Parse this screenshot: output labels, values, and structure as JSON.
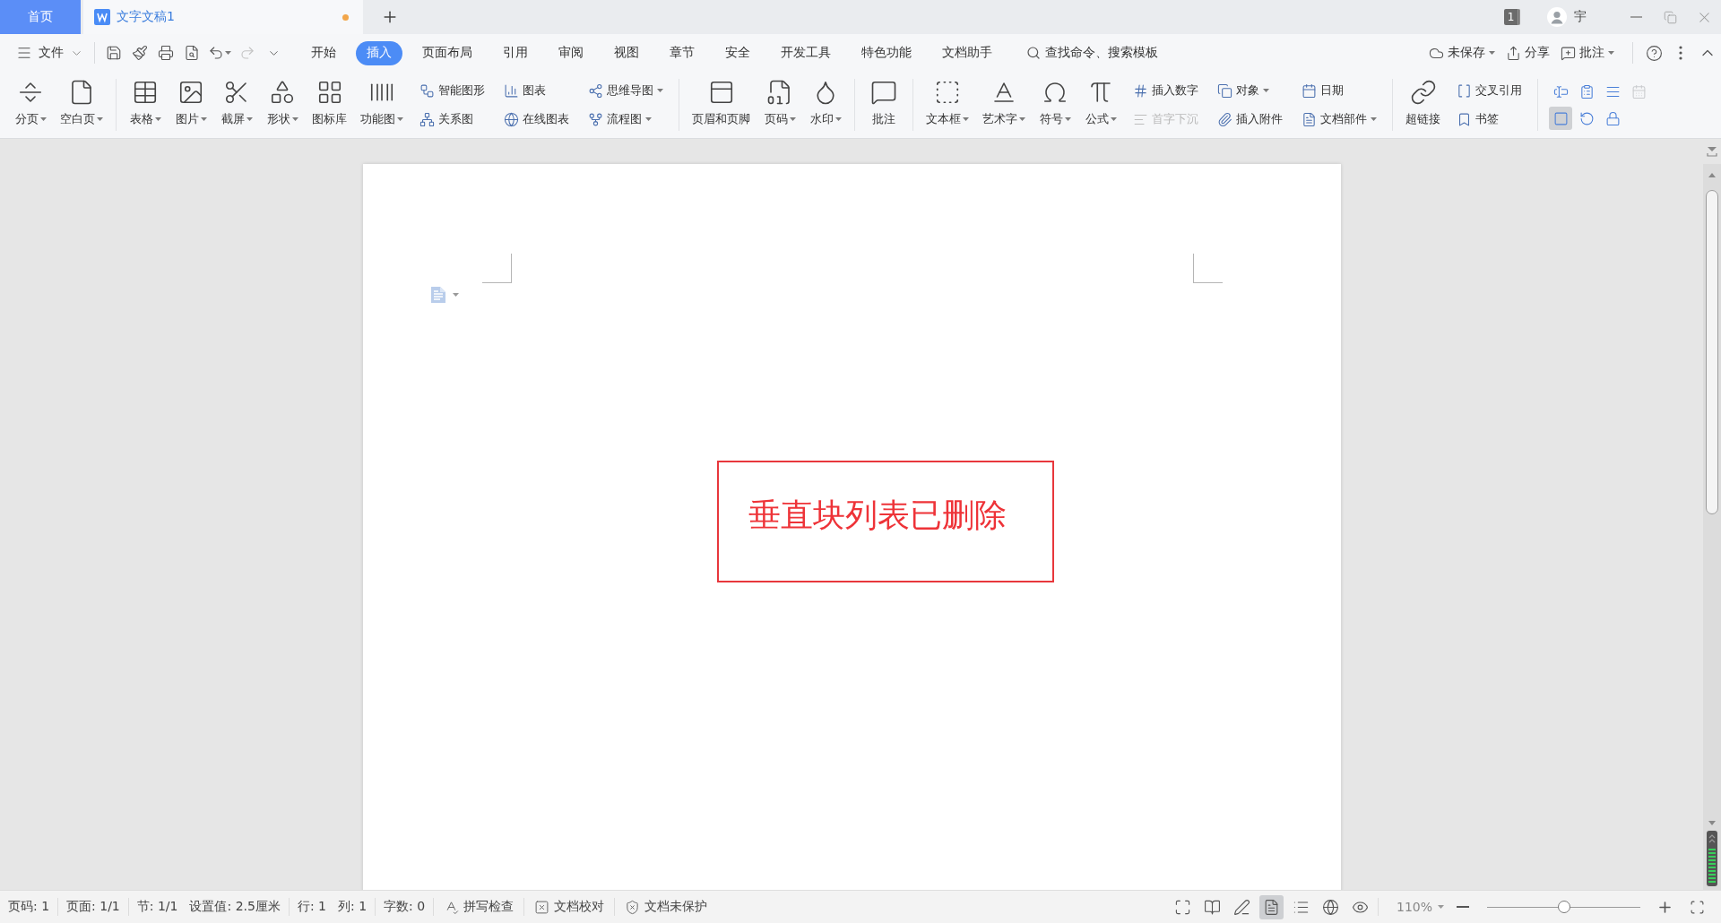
{
  "home_tab": {
    "label": "首页"
  },
  "document_tabs": [
    {
      "label": "文字文稿1",
      "selected": true,
      "unsaved": true
    }
  ],
  "account": {
    "window_count": "1",
    "user_name": "宇"
  },
  "menu": {
    "file_label": "文件",
    "redo_disabled": true,
    "tabs": [
      {
        "label": "开始",
        "selected": false
      },
      {
        "label": "插入",
        "selected": true
      },
      {
        "label": "页面布局",
        "selected": false
      },
      {
        "label": "引用",
        "selected": false
      },
      {
        "label": "审阅",
        "selected": false
      },
      {
        "label": "视图",
        "selected": false
      },
      {
        "label": "章节",
        "selected": false
      },
      {
        "label": "安全",
        "selected": false
      },
      {
        "label": "开发工具",
        "selected": false
      },
      {
        "label": "特色功能",
        "selected": false
      },
      {
        "label": "文档助手",
        "selected": false
      }
    ],
    "search_label": "查找命令、搜索模板",
    "actions": [
      {
        "label": "未保存",
        "dropdown": true
      },
      {
        "label": "分享",
        "dropdown": false
      },
      {
        "label": "批注",
        "dropdown": true
      }
    ]
  },
  "ribbon": [
    {
      "buttons": [
        {
          "label": "分页",
          "dropdown": true,
          "disabled": false
        },
        {
          "label": "空白页",
          "dropdown": true,
          "disabled": false
        }
      ]
    },
    {
      "buttons": [
        {
          "label": "表格",
          "dropdown": true,
          "disabled": false
        },
        {
          "label": "图片",
          "dropdown": true,
          "disabled": false
        },
        {
          "label": "截屏",
          "dropdown": true,
          "disabled": false
        },
        {
          "label": "形状",
          "dropdown": true,
          "disabled": false
        },
        {
          "label": "图标库",
          "dropdown": false,
          "disabled": false
        },
        {
          "label": "功能图",
          "dropdown": true,
          "disabled": false
        }
      ],
      "stacks": [
        [
          {
            "label": "智能图形",
            "dropdown": false,
            "disabled": false
          },
          {
            "label": "关系图",
            "dropdown": false,
            "disabled": false
          }
        ],
        [
          {
            "label": "图表",
            "dropdown": false,
            "disabled": false
          },
          {
            "label": "在线图表",
            "dropdown": false,
            "disabled": false
          }
        ],
        [
          {
            "label": "思维导图",
            "dropdown": true,
            "disabled": false
          },
          {
            "label": "流程图",
            "dropdown": true,
            "disabled": false
          }
        ]
      ]
    },
    {
      "buttons": [
        {
          "label": "页眉和页脚",
          "dropdown": false,
          "disabled": false
        },
        {
          "label": "页码",
          "dropdown": true,
          "disabled": false
        },
        {
          "label": "水印",
          "dropdown": true,
          "disabled": false
        }
      ]
    },
    {
      "buttons": [
        {
          "label": "批注",
          "dropdown": false,
          "disabled": false
        }
      ]
    },
    {
      "buttons": [
        {
          "label": "文本框",
          "dropdown": true,
          "disabled": false
        },
        {
          "label": "艺术字",
          "dropdown": true,
          "disabled": false
        },
        {
          "label": "符号",
          "dropdown": true,
          "disabled": false
        },
        {
          "label": "公式",
          "dropdown": true,
          "disabled": false
        }
      ],
      "stacks": [
        [
          {
            "label": "插入数字",
            "dropdown": false,
            "disabled": false
          },
          {
            "label": "首字下沉",
            "dropdown": false,
            "disabled": true
          }
        ],
        [
          {
            "label": "对象",
            "dropdown": true,
            "disabled": false
          },
          {
            "label": "插入附件",
            "dropdown": false,
            "disabled": false
          }
        ],
        [
          {
            "label": "日期",
            "dropdown": false,
            "disabled": false
          },
          {
            "label": "文档部件",
            "dropdown": true,
            "disabled": false
          }
        ]
      ]
    },
    {
      "buttons": [
        {
          "label": "超链接",
          "dropdown": false,
          "disabled": false
        }
      ],
      "stacks": [
        [
          {
            "label": "交叉引用",
            "dropdown": false,
            "disabled": false
          },
          {
            "label": "书签",
            "dropdown": false,
            "disabled": false
          }
        ]
      ]
    },
    {
      "controls": [
        [
          {
            "selected": false,
            "disabled": false
          },
          {
            "selected": false,
            "disabled": false
          },
          {
            "selected": false,
            "disabled": false
          },
          {
            "selected": false,
            "disabled": true
          }
        ],
        [
          {
            "selected": true,
            "disabled": false
          },
          {
            "selected": false,
            "disabled": false
          },
          {
            "selected": false,
            "disabled": false
          }
        ]
      ]
    }
  ],
  "document": {
    "text_box": "垂直块列表已删除"
  },
  "status_bar": {
    "fields": [
      [
        "页码: 1"
      ],
      [
        "页面: 1/1"
      ],
      [
        "节: 1/1",
        "设置值: 2.5厘米"
      ],
      [
        "行: 1",
        "列: 1"
      ],
      [
        "字数: 0"
      ]
    ],
    "tools": [
      "拼写检查",
      "文档校对",
      "文档未保护"
    ],
    "view_modes": [
      {
        "selected": false
      },
      {
        "selected": false
      },
      {
        "selected": false
      },
      {
        "selected": true
      },
      {
        "selected": false
      },
      {
        "selected": false
      },
      {
        "selected": false
      }
    ],
    "zoom": {
      "label": "110%",
      "level": 0.5
    }
  }
}
